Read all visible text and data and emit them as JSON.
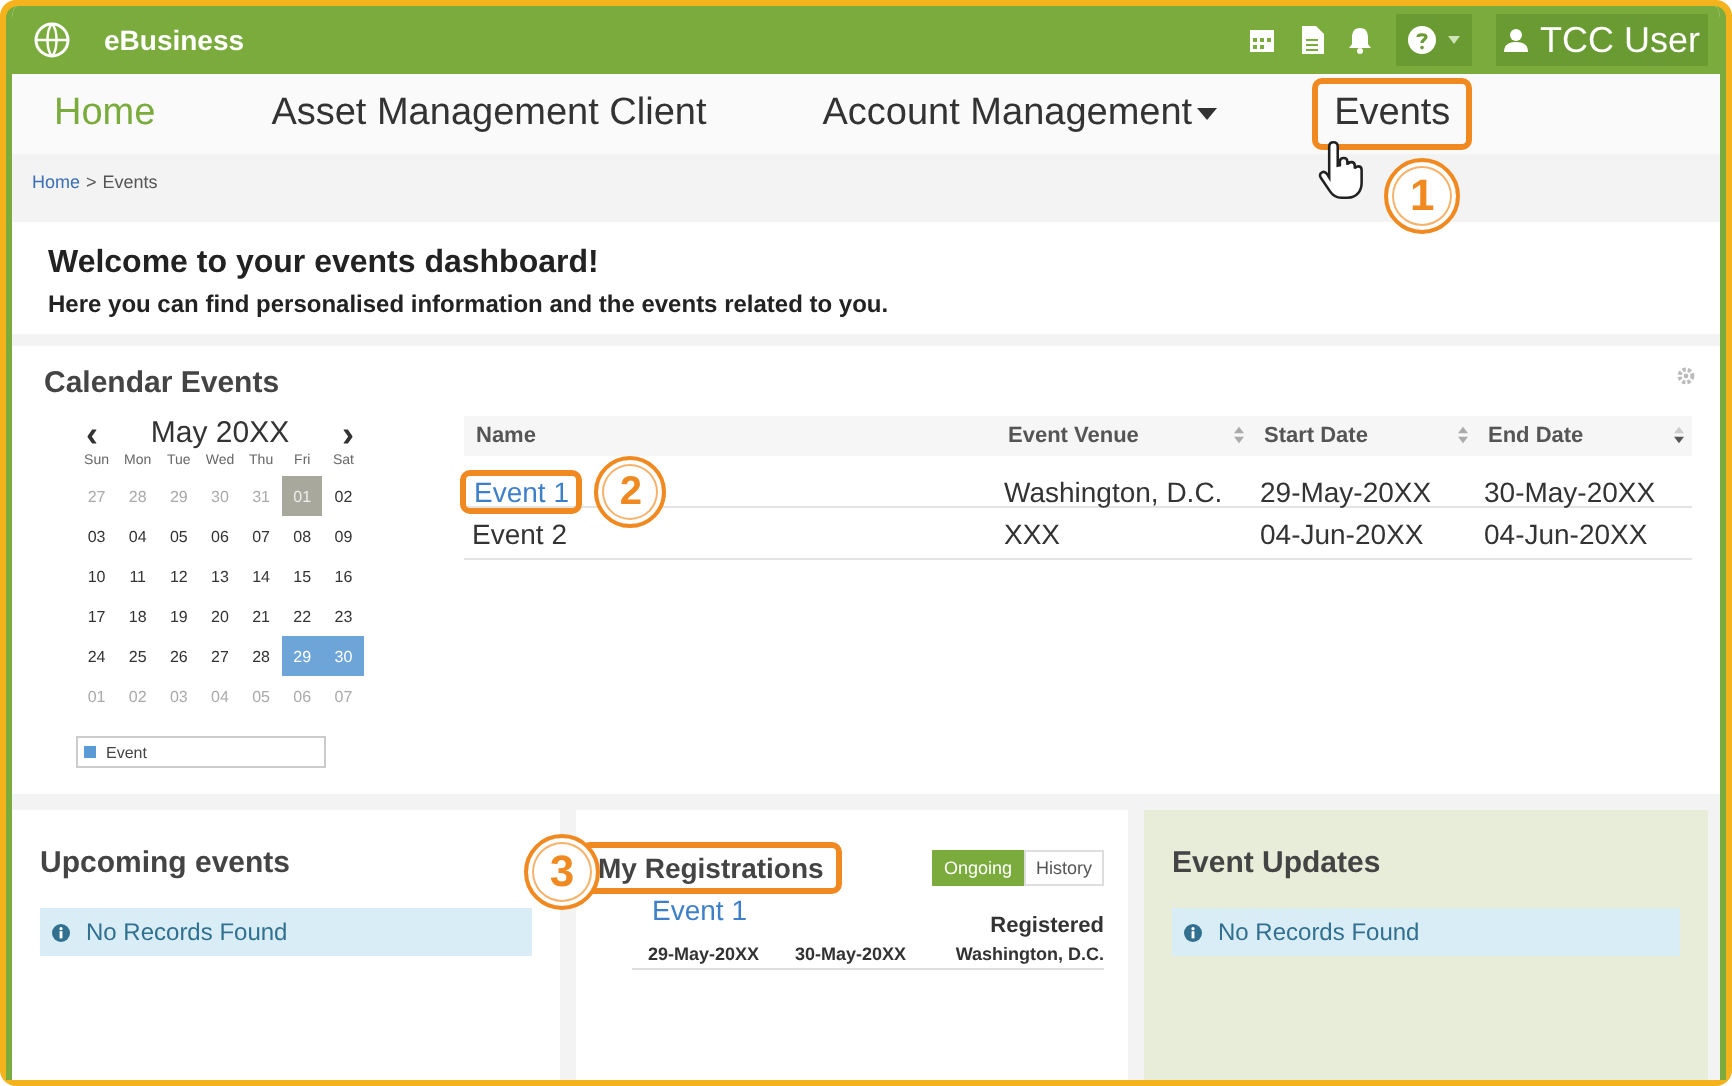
{
  "topbar": {
    "brand": "eBusiness",
    "user": "TCC User"
  },
  "nav": [
    {
      "label": "Home",
      "selected": true,
      "dropdown": false
    },
    {
      "label": "Asset Management Client",
      "selected": false,
      "dropdown": false
    },
    {
      "label": "Account Management",
      "selected": false,
      "dropdown": true
    },
    {
      "label": "Events",
      "selected": false,
      "dropdown": false,
      "callout": "1",
      "pointer": true
    }
  ],
  "breadcrumb": [
    {
      "label": "Home",
      "link": true,
      "separator": ">"
    },
    {
      "label": "Events",
      "link": false
    }
  ],
  "welcome": {
    "title": "Welcome to your events dashboard!",
    "subtitle": "Here you can find personalised information and the events related to you."
  },
  "calendar": {
    "title": "Calendar Events",
    "month": "May 20XX",
    "prev": "‹",
    "next": "›",
    "weekdays": [
      "Sun",
      "Mon",
      "Tue",
      "Wed",
      "Thu",
      "Fri",
      "Sat"
    ],
    "weeks": [
      [
        {
          "label": "27",
          "kind": "other"
        },
        {
          "label": "28",
          "kind": "other"
        },
        {
          "label": "29",
          "kind": "other"
        },
        {
          "label": "30",
          "kind": "other"
        },
        {
          "label": "31",
          "kind": "other"
        },
        {
          "label": "01",
          "kind": "today"
        },
        {
          "label": "02",
          "kind": "normal"
        }
      ],
      [
        {
          "label": "03",
          "kind": "normal"
        },
        {
          "label": "04",
          "kind": "normal"
        },
        {
          "label": "05",
          "kind": "normal"
        },
        {
          "label": "06",
          "kind": "normal"
        },
        {
          "label": "07",
          "kind": "normal"
        },
        {
          "label": "08",
          "kind": "normal"
        },
        {
          "label": "09",
          "kind": "normal"
        }
      ],
      [
        {
          "label": "10",
          "kind": "normal"
        },
        {
          "label": "11",
          "kind": "normal"
        },
        {
          "label": "12",
          "kind": "normal"
        },
        {
          "label": "13",
          "kind": "normal"
        },
        {
          "label": "14",
          "kind": "normal"
        },
        {
          "label": "15",
          "kind": "normal"
        },
        {
          "label": "16",
          "kind": "normal"
        }
      ],
      [
        {
          "label": "17",
          "kind": "normal"
        },
        {
          "label": "18",
          "kind": "normal"
        },
        {
          "label": "19",
          "kind": "normal"
        },
        {
          "label": "20",
          "kind": "normal"
        },
        {
          "label": "21",
          "kind": "normal"
        },
        {
          "label": "22",
          "kind": "normal"
        },
        {
          "label": "23",
          "kind": "normal"
        }
      ],
      [
        {
          "label": "24",
          "kind": "normal"
        },
        {
          "label": "25",
          "kind": "normal"
        },
        {
          "label": "26",
          "kind": "normal"
        },
        {
          "label": "27",
          "kind": "normal"
        },
        {
          "label": "28",
          "kind": "normal"
        },
        {
          "label": "29",
          "kind": "event"
        },
        {
          "label": "30",
          "kind": "event"
        }
      ],
      [
        {
          "label": "01",
          "kind": "other"
        },
        {
          "label": "02",
          "kind": "other"
        },
        {
          "label": "03",
          "kind": "other"
        },
        {
          "label": "04",
          "kind": "other"
        },
        {
          "label": "05",
          "kind": "other"
        },
        {
          "label": "06",
          "kind": "other"
        },
        {
          "label": "07",
          "kind": "other"
        }
      ]
    ],
    "legend": {
      "label": "Event",
      "color": "#5b9bd5"
    }
  },
  "events_table": {
    "columns": [
      {
        "label": "Name",
        "kind": "plain"
      },
      {
        "label": "Event Venue",
        "kind": "sortable"
      },
      {
        "label": "Start Date",
        "kind": "sortable"
      },
      {
        "label": "End Date",
        "kind": "sorted"
      }
    ],
    "rows": [
      {
        "name": "Event 1",
        "link": true,
        "callout": "2",
        "venue": "Washington, D.C.",
        "start": "29-May-20XX",
        "end": "30-May-20XX"
      },
      {
        "name": "Event 2",
        "link": false,
        "venue": "XXX",
        "start": "04-Jun-20XX",
        "end": "04-Jun-20XX"
      }
    ]
  },
  "upcoming": {
    "title": "Upcoming events",
    "message": "No Records Found"
  },
  "registrations": {
    "title": "My Registrations",
    "callout": "3",
    "tabs": [
      {
        "label": "Ongoing",
        "selected": true
      },
      {
        "label": "History",
        "selected": false
      }
    ],
    "items": [
      {
        "name": "Event 1",
        "status": "Registered",
        "start": "29-May-20XX",
        "end": "30-May-20XX",
        "venue": "Washington, D.C."
      }
    ]
  },
  "updates": {
    "title": "Event Updates",
    "message": "No Records Found"
  }
}
